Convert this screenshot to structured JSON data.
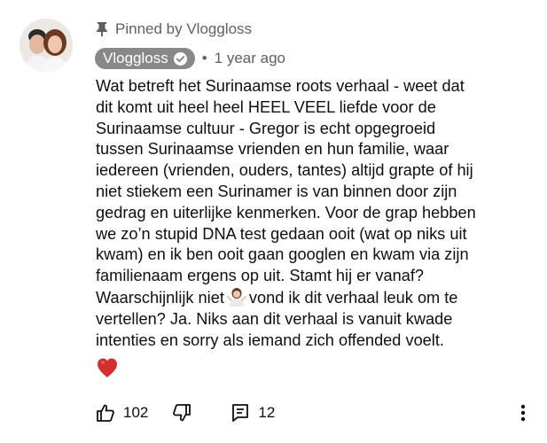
{
  "comment": {
    "pinned_label": "Pinned by Vloggloss",
    "author": "Vloggloss",
    "separator": "•",
    "time": "1 year ago",
    "text_part1": "Wat betreft het Surinaamse roots verhaal - weet dat\ndit komt uit heel heel HEEL VEEL liefde voor de\nSurinaamse cultuur - Gregor is echt opgegroeid\ntussen Surinaamse vrienden en hun familie, waar\niedereen (vrienden, ouders, tantes) altijd grapte of hij\nniet stiekem een Surinamer is van binnen door zijn\ngedrag en uiterlijke kenmerken. Voor de grap hebben\nwe zo’n stupid DNA test gedaan ooit (wat op niks uit\nkwam) en ik ben ooit gaan googlen en kwam via zijn\nfamilienaam ergens op uit. Stamt hij er vanaf?\nWaarschijnlijk niet",
    "text_part2": "vond ik dit verhaal leuk om te\nvertellen? Ja. Niks aan dit verhaal is vanuit kwade\nintenties en sorry als iemand zich offended voelt.",
    "inline_emoji": "woman-shrugging-emoji",
    "trailing_emoji": "red-heart-emoji"
  },
  "actions": {
    "like_count": "102",
    "reply_count": "12"
  },
  "icons": {
    "pin": "pin-icon",
    "verified": "verified-check-icon",
    "like": "thumb-up-icon",
    "dislike": "thumb-down-icon",
    "replies": "comment-icon",
    "more": "more-vertical-icon"
  },
  "colors": {
    "text": "#0f0f0f",
    "secondary": "#606060",
    "author_chip_bg": "#888888",
    "heart": "#d32f2f"
  }
}
